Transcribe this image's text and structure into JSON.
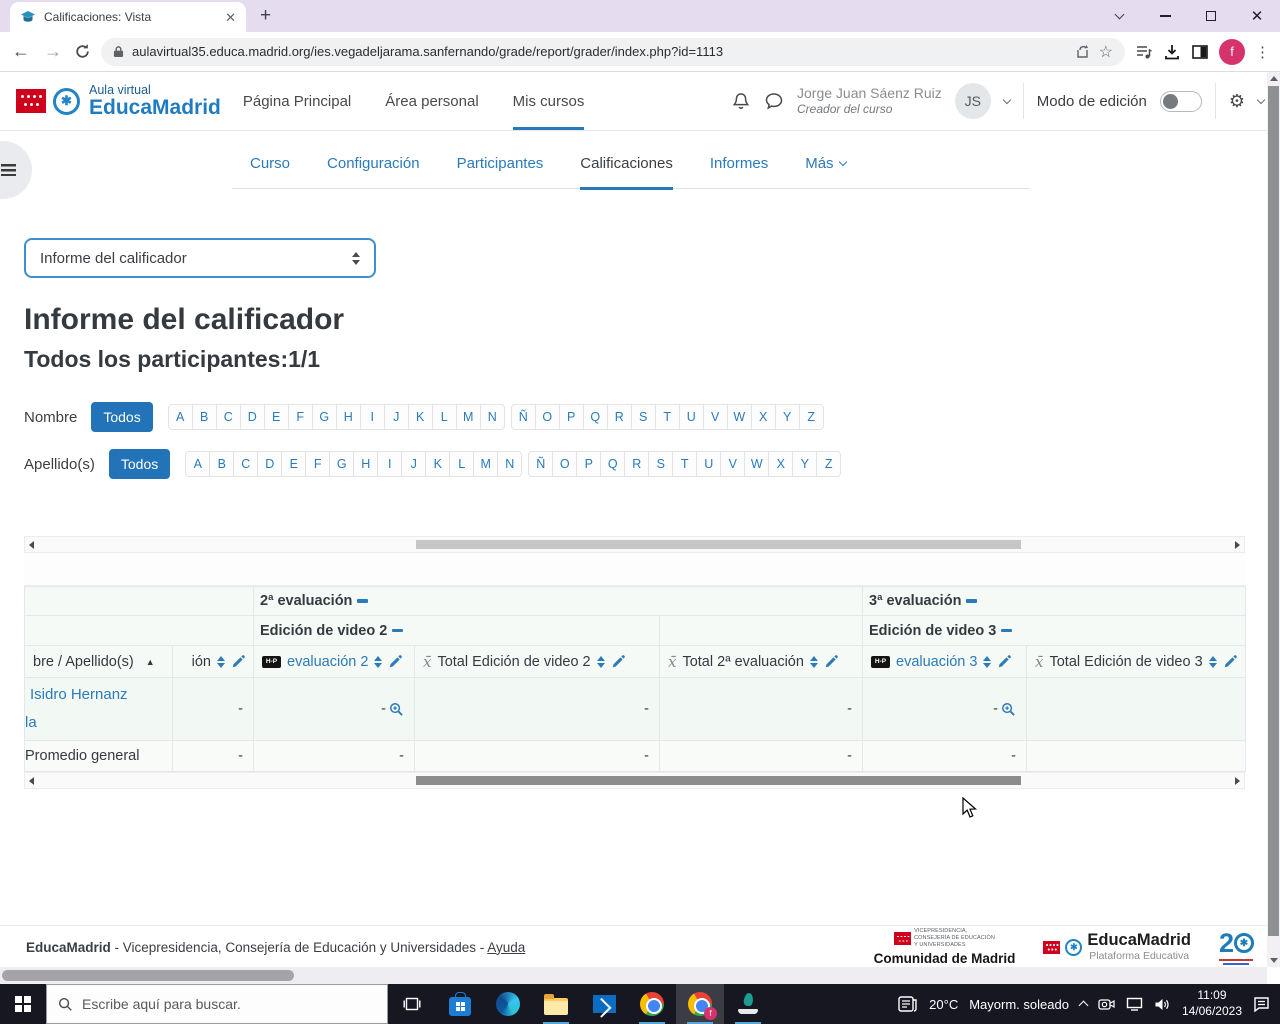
{
  "browser": {
    "tab_title": "Calificaciones: Vista",
    "url": "aulavirtual35.educa.madrid.org/ies.vegadeljarama.sanfernando/grade/report/grader/index.php?id=1113",
    "profile_initial": "f"
  },
  "header": {
    "brand_top": "Aula virtual",
    "brand_name": "EducaMadrid",
    "nav_items": [
      {
        "label": "Página Principal",
        "active": false
      },
      {
        "label": "Área personal",
        "active": false
      },
      {
        "label": "Mis cursos",
        "active": true
      }
    ],
    "user": {
      "name": "Jorge Juan Sáenz Ruiz",
      "role": "Creador del curso",
      "initials": "JS"
    },
    "edit_mode_label": "Modo de edición"
  },
  "course_nav": {
    "tabs": [
      {
        "label": "Curso",
        "active": false,
        "dropdown": false
      },
      {
        "label": "Configuración",
        "active": false,
        "dropdown": false
      },
      {
        "label": "Participantes",
        "active": false,
        "dropdown": false
      },
      {
        "label": "Calificaciones",
        "active": true,
        "dropdown": false
      },
      {
        "label": "Informes",
        "active": false,
        "dropdown": false
      },
      {
        "label": "Más",
        "active": false,
        "dropdown": true
      }
    ]
  },
  "report": {
    "view_selector": "Informe del calificador",
    "title": "Informe del calificador",
    "subtitle": "Todos los participantes:1/1",
    "filters": [
      {
        "label": "Nombre",
        "all": "Todos",
        "letters1": [
          "A",
          "B",
          "C",
          "D",
          "E",
          "F",
          "G",
          "H",
          "I",
          "J",
          "K",
          "L",
          "M",
          "N"
        ],
        "letters2": [
          "Ñ",
          "O",
          "P",
          "Q",
          "R",
          "S",
          "T",
          "U",
          "V",
          "W",
          "X",
          "Y",
          "Z"
        ]
      },
      {
        "label": "Apellido(s)",
        "all": "Todos",
        "letters1": [
          "A",
          "B",
          "C",
          "D",
          "E",
          "F",
          "G",
          "H",
          "I",
          "J",
          "K",
          "L",
          "M",
          "N"
        ],
        "letters2": [
          "Ñ",
          "O",
          "P",
          "Q",
          "R",
          "S",
          "T",
          "U",
          "V",
          "W",
          "X",
          "Y",
          "Z"
        ]
      }
    ]
  },
  "grade_table": {
    "categories": [
      {
        "label": "2ª evaluación"
      },
      {
        "label": "3ª evaluación"
      }
    ],
    "subcategories": [
      {
        "label": "Edición de video 2"
      },
      {
        "label": "Edición de video 3"
      }
    ],
    "columns": [
      {
        "label": "bre / Apellido(s)",
        "type": "name"
      },
      {
        "label": "ión",
        "type": "plain"
      },
      {
        "label": "evaluación 2",
        "type": "h5p"
      },
      {
        "label": "Total Edición de video 2",
        "type": "total"
      },
      {
        "label": "Total 2ª evaluación",
        "type": "total"
      },
      {
        "label": "evaluación 3",
        "type": "h5p"
      },
      {
        "label": "Total Edición de video 3",
        "type": "total"
      }
    ],
    "rows": [
      {
        "name_line1": "Isidro Hernanz",
        "name_line2": "la",
        "values": [
          {
            "text": "-",
            "zoom": false
          },
          {
            "text": "-",
            "zoom": true
          },
          {
            "text": "-",
            "zoom": false
          },
          {
            "text": "-",
            "zoom": false
          },
          {
            "text": "-",
            "zoom": true
          },
          {
            "text": "",
            "zoom": false
          }
        ]
      }
    ],
    "average_row": {
      "label": "Promedio general",
      "values": [
        "-",
        "-",
        "-",
        "-",
        "-",
        ""
      ]
    }
  },
  "footer": {
    "brand": "EducaMadrid",
    "text": " - Vicepresidencia, Consejería de Educación y Universidades - ",
    "help": "Ayuda",
    "cm_lines": [
      "VICEPRESIDENCIA,",
      "CONSEJERÍA DE EDUCACIÓN",
      "Y UNIVERSIDADES"
    ],
    "cm_name": "Comunidad de Madrid",
    "em_name": "EducaMadrid",
    "em_sub": "Plataforma Educativa",
    "anniversary_number": "2"
  },
  "taskbar": {
    "search_placeholder": "Escribe aquí para buscar.",
    "weather_temp": "20°C",
    "weather_desc": "Mayorm. soleado",
    "time": "11:09",
    "date": "14/06/2023"
  }
}
